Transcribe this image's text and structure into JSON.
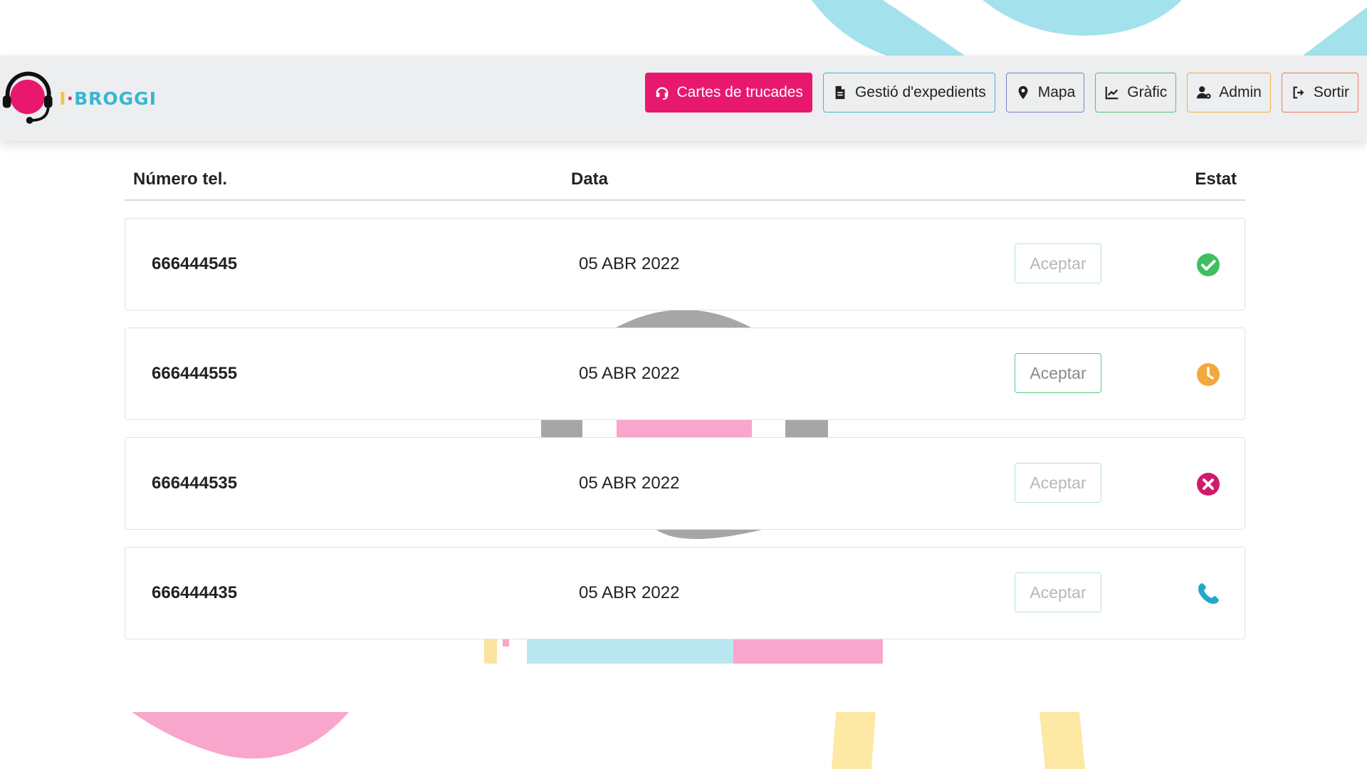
{
  "app": {
    "logo_text_part1": "I",
    "logo_text_part2": "·",
    "logo_text_part3": "BROGGI",
    "watermark_text": "I·BROGGI"
  },
  "colors": {
    "brand_pink": "#e8186f",
    "brand_blue": "#38b6d0",
    "brand_yellow": "#f3c44a",
    "status_ok": "#3fbf5f",
    "status_pending": "#f2a93b",
    "status_rejected": "#d01a6b",
    "status_call": "#21a9c7"
  },
  "nav": {
    "items": [
      {
        "label": "Cartes de trucades",
        "icon": "headset-icon",
        "active": true
      },
      {
        "label": "Gestió d'expedients",
        "icon": "file-icon",
        "active": false
      },
      {
        "label": "Mapa",
        "icon": "map-marker-icon",
        "active": false
      },
      {
        "label": "Gràfic",
        "icon": "line-chart-icon",
        "active": false
      },
      {
        "label": "Admin",
        "icon": "user-cog-icon",
        "active": false
      },
      {
        "label": "Sortir",
        "icon": "sign-out-icon",
        "active": false
      }
    ]
  },
  "table": {
    "headers": {
      "number": "Número tel.",
      "date": "Data",
      "status": "Estat"
    },
    "rows": [
      {
        "number": "666444545",
        "date": "05 ABR 2022",
        "action": "Aceptar",
        "action_enabled": false,
        "status": "check-circle-icon"
      },
      {
        "number": "666444555",
        "date": "05 ABR 2022",
        "action": "Aceptar",
        "action_enabled": true,
        "status": "clock-icon"
      },
      {
        "number": "666444535",
        "date": "05 ABR 2022",
        "action": "Aceptar",
        "action_enabled": false,
        "status": "times-circle-icon"
      },
      {
        "number": "666444435",
        "date": "05 ABR 2022",
        "action": "Aceptar",
        "action_enabled": false,
        "status": "phone-icon"
      }
    ]
  }
}
